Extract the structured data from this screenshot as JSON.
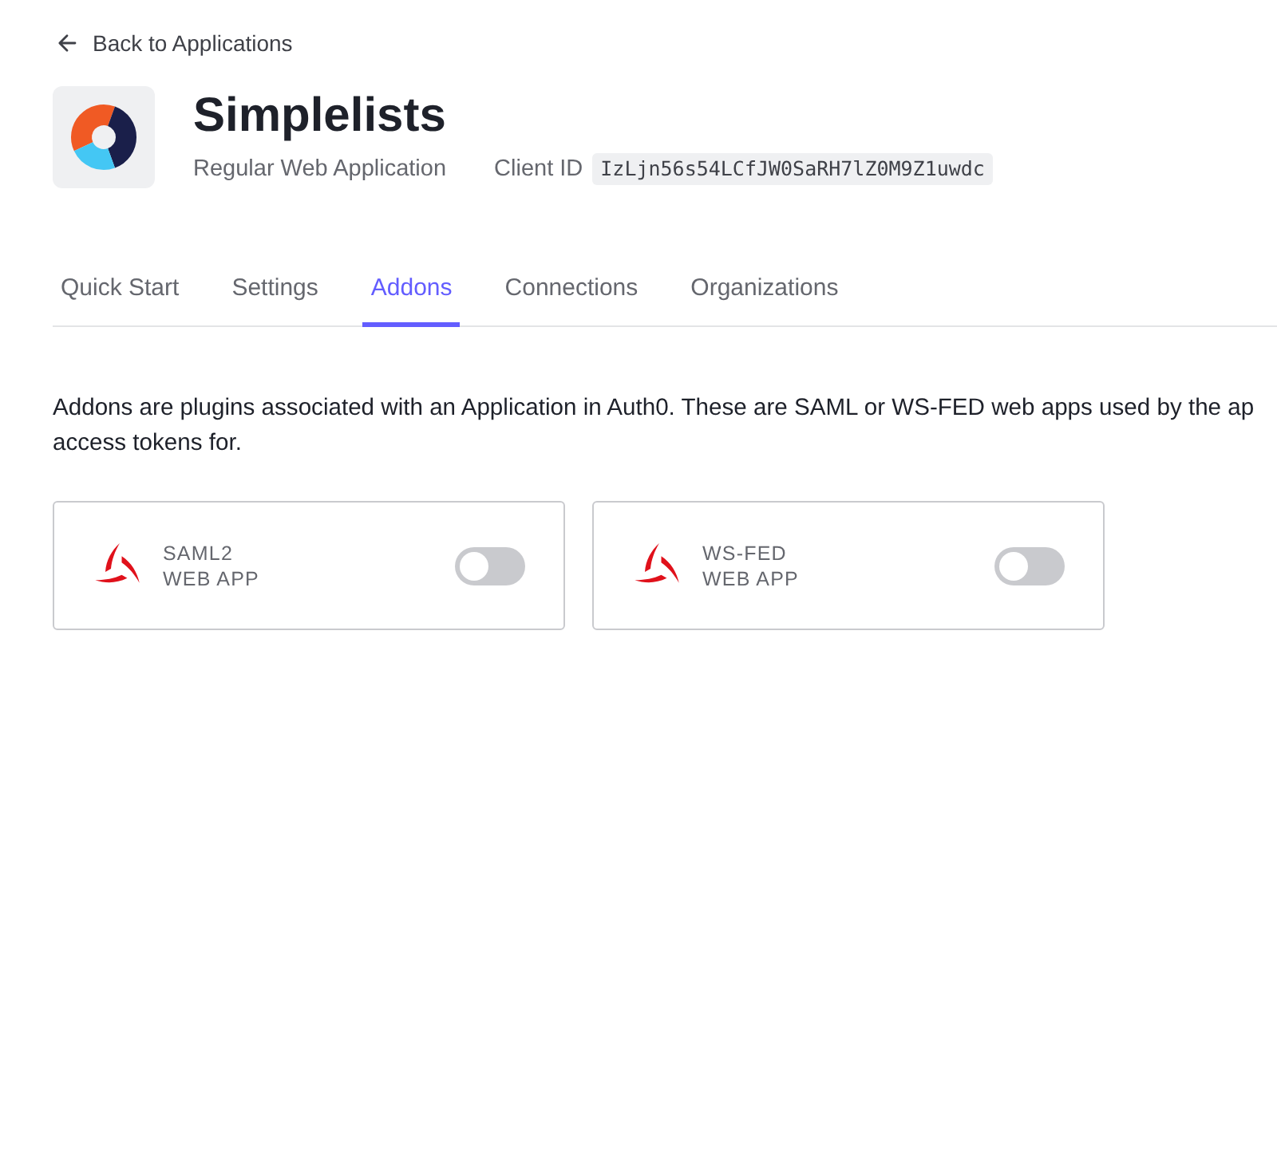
{
  "back_link": {
    "label": "Back to Applications"
  },
  "app": {
    "name": "Simplelists",
    "type": "Regular Web Application",
    "client_id_label": "Client ID",
    "client_id": "IzLjn56s54LCfJW0SaRH7lZ0M9Z1uwdc"
  },
  "tabs": [
    {
      "label": "Quick Start",
      "selected": false
    },
    {
      "label": "Settings",
      "selected": false
    },
    {
      "label": "Addons",
      "selected": true
    },
    {
      "label": "Connections",
      "selected": false
    },
    {
      "label": "Organizations",
      "selected": false
    }
  ],
  "description": [
    "Addons are plugins associated with an Application in Auth0. These are SAML or WS-FED web apps used by the ap",
    "access tokens for."
  ],
  "addons": [
    {
      "title": "SAML2",
      "subtitle": "WEB APP",
      "on": false
    },
    {
      "title": "WS-FED",
      "subtitle": "WEB APP",
      "on": false
    }
  ]
}
